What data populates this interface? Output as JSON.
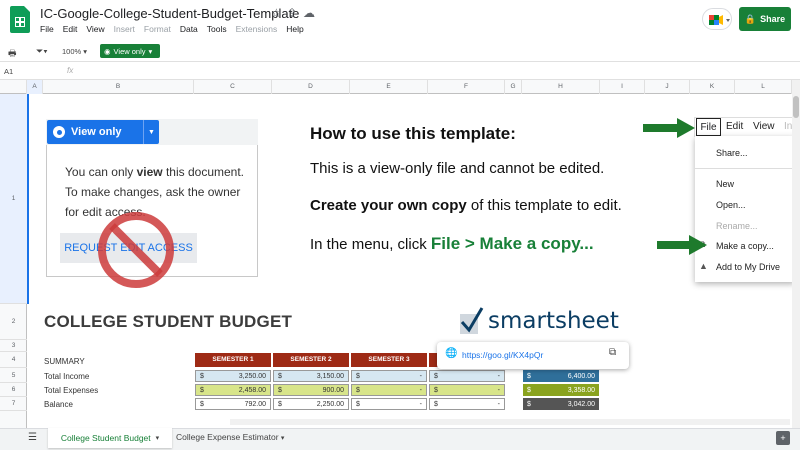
{
  "app": {
    "doc_title": "IC-Google-College-Student-Budget-Template",
    "share_label": "Share",
    "menus": [
      "File",
      "Edit",
      "View",
      "Insert",
      "Format",
      "Data",
      "Tools",
      "Extensions",
      "Help"
    ]
  },
  "toolbar": {
    "zoom": "100%",
    "view_only_label": "View only",
    "cell_ref": "A1",
    "fx": "fx"
  },
  "grid": {
    "columns": [
      "A",
      "B",
      "C",
      "D",
      "E",
      "F",
      "G",
      "H",
      "I",
      "J",
      "K",
      "L"
    ],
    "rows": [
      "1",
      "2",
      "3",
      "4",
      "5",
      "6",
      "7"
    ]
  },
  "card": {
    "pill_label": "View only",
    "line1_pre": "You can only ",
    "line1_bold": "view",
    "line1_post": " this document.",
    "line2": "To make changes, ask the owner",
    "line3": "for edit access.",
    "request_button": "REQUEST EDIT ACCESS"
  },
  "instructions": {
    "heading": "How to use this template:",
    "line1": "This is a view-only file and cannot be edited.",
    "line2_bold": "Create your own copy",
    "line2_rest": " of this template to edit.",
    "line3_pre": "In the menu, click ",
    "line3_green": "File > Make a copy..."
  },
  "file_menu": {
    "bar": [
      "File",
      "Edit",
      "View",
      "Ins"
    ],
    "items": [
      "Share...",
      "New",
      "Open...",
      "Rename...",
      "Make a copy...",
      "Add to My Drive"
    ]
  },
  "budget": {
    "title": "COLLEGE STUDENT BUDGET",
    "brand": "smartsheet",
    "summary_label": "SUMMARY",
    "row_labels": [
      "Total Income",
      "Total Expenses",
      "Balance"
    ],
    "semesters": [
      "SEMESTER 1",
      "SEMESTER 2",
      "SEMESTER 3"
    ],
    "currency": "$",
    "sem1": [
      "3,250.00",
      "2,458.00",
      "792.00"
    ],
    "sem2": [
      "3,150.00",
      "900.00",
      "2,250.00"
    ],
    "sem3": [
      "-",
      "-",
      "-"
    ],
    "sem4": [
      "-",
      "-",
      "-"
    ],
    "totals": [
      "6,400.00",
      "3,358.00",
      "3,042.00"
    ],
    "colors": {
      "header": "#9e2a15",
      "income": "#d6e7f1",
      "expense": "#d8e58a",
      "tot_income": "#2f6f9a",
      "tot_expense": "#8aa31f",
      "tot_balance": "#555555"
    }
  },
  "link_popup": {
    "url": "https://goo.gl/KX4pQr"
  },
  "sheets": {
    "tabs": [
      "College Student Budget",
      "College Expense Estimator"
    ]
  }
}
